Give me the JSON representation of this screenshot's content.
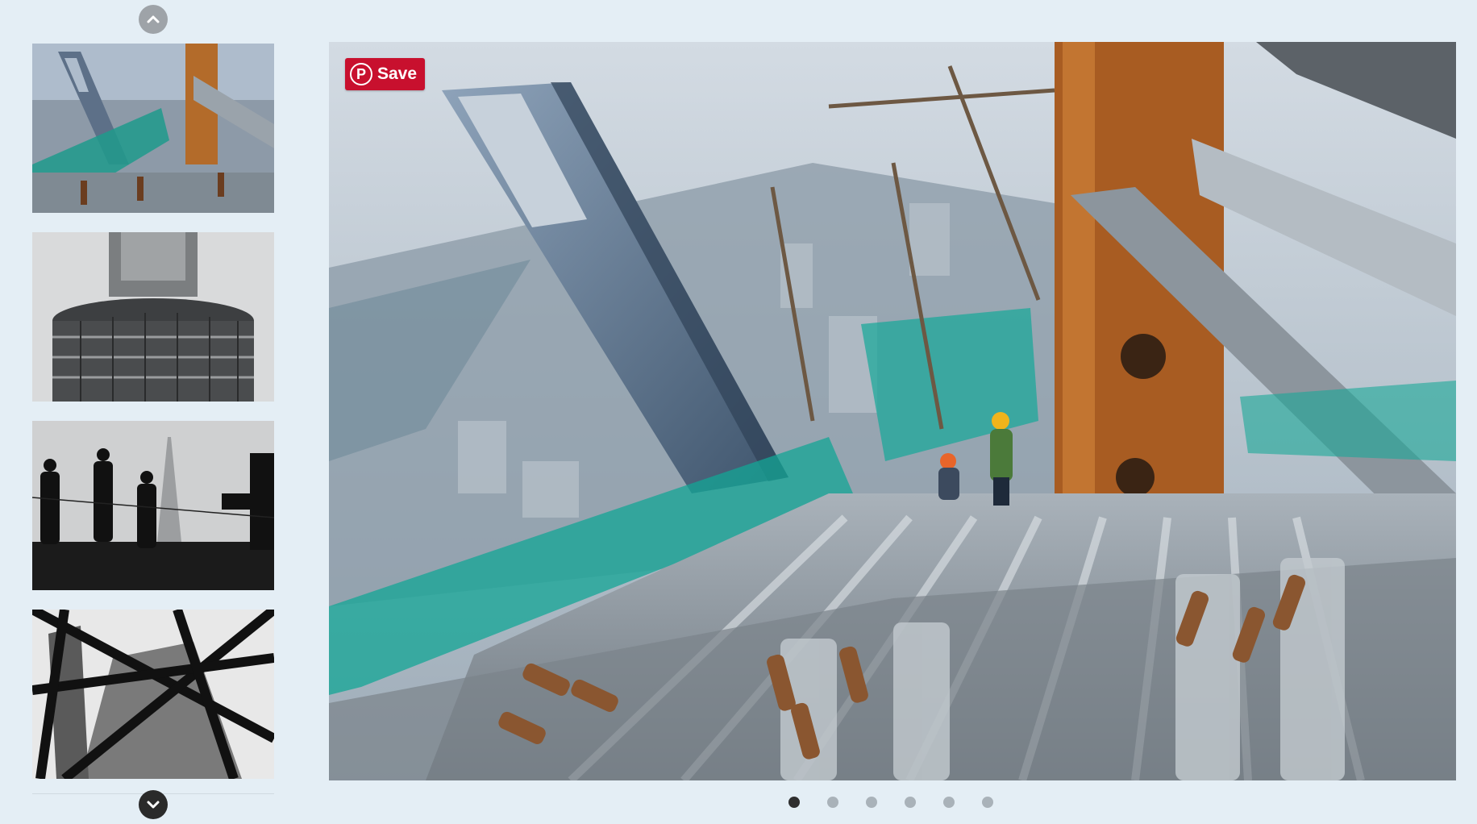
{
  "gallery": {
    "nav_up_icon": "chevron-up-icon",
    "nav_down_icon": "chevron-down-icon",
    "thumbnails": [
      {
        "subject": "aerial-construction-skyscraper"
      },
      {
        "subject": "tower-top-under-construction"
      },
      {
        "subject": "silhouettes-of-workers"
      },
      {
        "subject": "steel-frame-looking-up"
      }
    ]
  },
  "pin": {
    "label": "Save",
    "logo_glyph": "P",
    "color": "#c8102e"
  },
  "pagination": {
    "count": 6,
    "active_index": 0
  },
  "colors": {
    "background": "#e4eef5",
    "dot_active": "#2f2f2f",
    "dot_inactive": "#a9b2b9"
  }
}
